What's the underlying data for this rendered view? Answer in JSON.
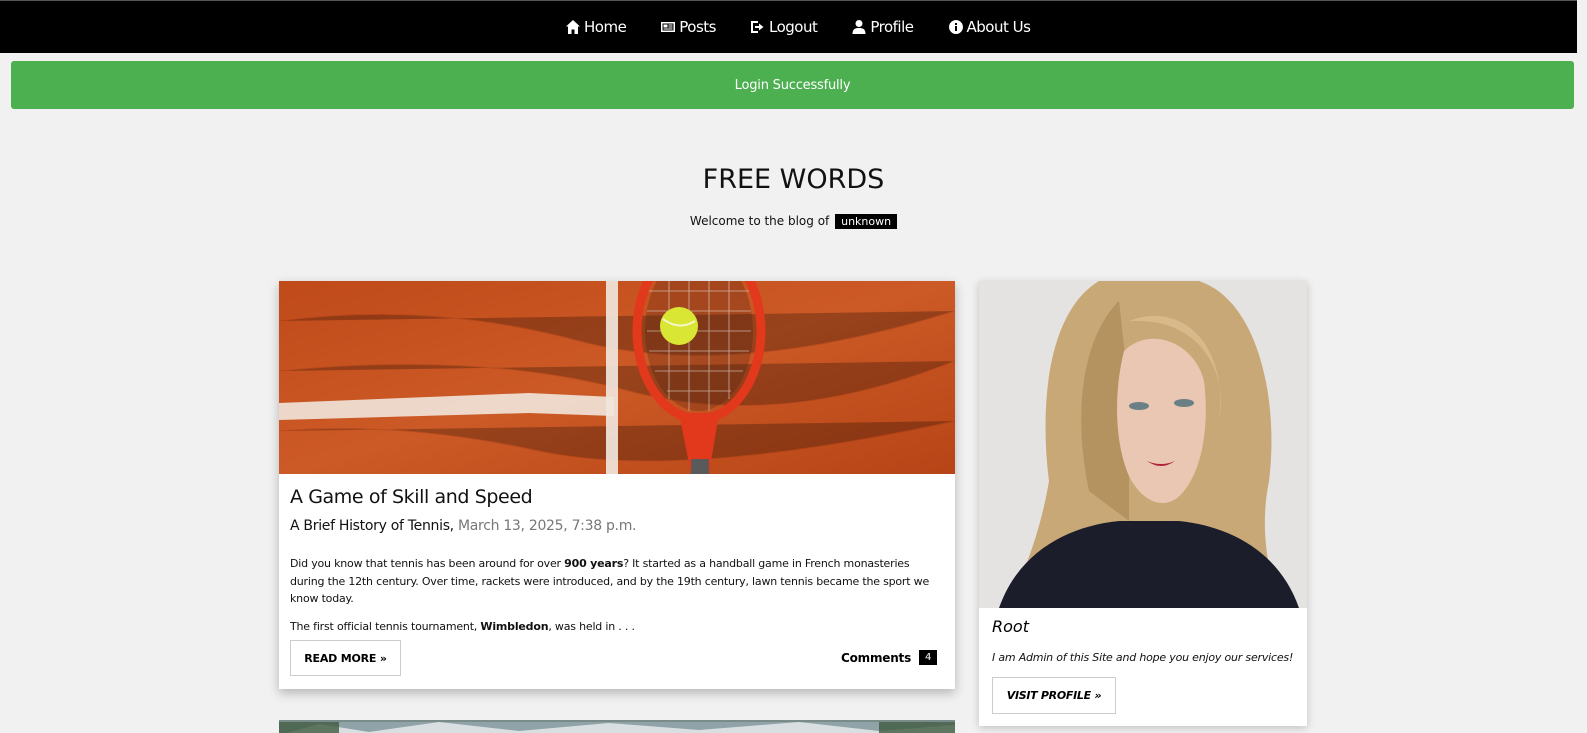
{
  "nav": {
    "items": [
      {
        "label": "Home",
        "icon": "home-icon"
      },
      {
        "label": "Posts",
        "icon": "newspaper-icon"
      },
      {
        "label": "Logout",
        "icon": "sign-out-icon"
      },
      {
        "label": "Profile",
        "icon": "user-icon"
      },
      {
        "label": "About Us",
        "icon": "info-circle-icon"
      }
    ]
  },
  "alert": {
    "message": "Login Successfully",
    "color": "#4caf50"
  },
  "site": {
    "title": "FREE WORDS",
    "welcome_text": "Welcome to the blog of",
    "welcome_tag": "unknown"
  },
  "post": {
    "title": "A Game of Skill and Speed",
    "subtitle": "A Brief History of Tennis,",
    "date": "March 13, 2025, 7:38 p.m.",
    "p1_a": "Did you know that tennis has been around for over ",
    "p1_bold": "900 years",
    "p1_b": "? It started as a handball game in French monasteries during the 12th century. Over time, rackets were introduced, and by the 19th century, lawn tennis became the sport we know today.",
    "p2_a": "The first official tennis tournament, ",
    "p2_bold": "Wimbledon",
    "p2_b": ", was held in . . .",
    "read_more": "READ MORE »",
    "comments_label": "Comments",
    "comments_count": "4"
  },
  "profile": {
    "name": "Root",
    "description": "I am Admin of this Site and hope you enjoy our services!",
    "button": "VISIT PROFILE »"
  }
}
